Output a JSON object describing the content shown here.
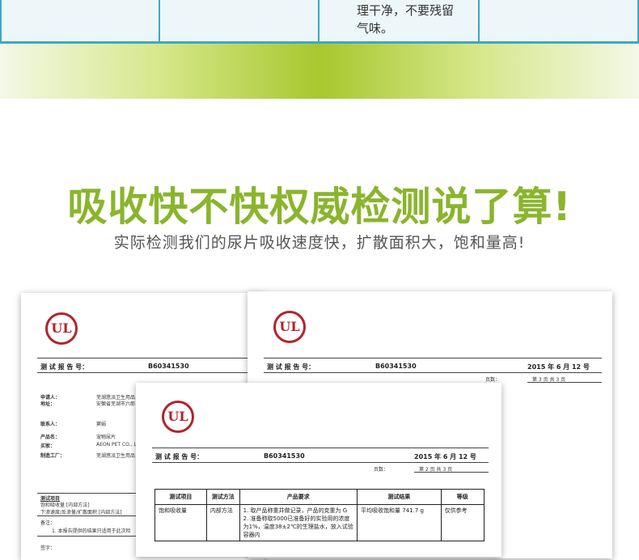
{
  "top_table": {
    "cell_text_line1": "理干净，不要残留",
    "cell_text_line2": "气味。"
  },
  "headline": "吸收快不快权威检测说了算!",
  "subheadline": "实际检测我们的尿片吸收速度快，扩散面积大，饱和量高!",
  "docs": {
    "logo_text": "UL",
    "report_label": "测 试 报 告 号：",
    "report_no": "B60341530",
    "date": "2015 年 6 月 12 号",
    "pages_label": "页数：",
    "page_of": "第 3 页 共 3 页",
    "page_of_front": "第 2 页 共 3 页",
    "left_doc": {
      "applicant_label": "申请人：",
      "applicant_value": "芜湖悠派卫生用品",
      "address_label": "地址：",
      "address_value": "安徽省芜湖市六郎",
      "contact_label": "联系人：",
      "contact_value": "窦娟",
      "product_label": "产品名：",
      "product_value": "宠物尿片",
      "buyer_label": "买家：",
      "buyer_value": "AEON PET CO., L",
      "factory_label": "制造工厂：",
      "factory_value": "芜湖悠派卫生用品",
      "items_title": "测试项目",
      "item1": "饱和吸收量 [内部方法]",
      "item2": "下渗速度/反渗量/扩散面积 [内部方法]",
      "note_label": "备注：",
      "note1": "1.    本报告提供的结果只适用于此次检",
      "footer_label": "签字："
    },
    "front_table": {
      "headers": [
        "测试项目",
        "测试方法",
        "产品要求",
        "测试结果",
        "等级"
      ],
      "row1": [
        "饱和吸收量",
        "内部方法",
        "1. 取产品称重并做记录，产品的克重为 G",
        "平均吸收饱和量 741.7 g",
        "仅供参考"
      ],
      "req2": "2. 准备称取5000已准备好的实验用的浓度为1%，温度38±2℃的生理盐水，放入试验容器内"
    }
  }
}
